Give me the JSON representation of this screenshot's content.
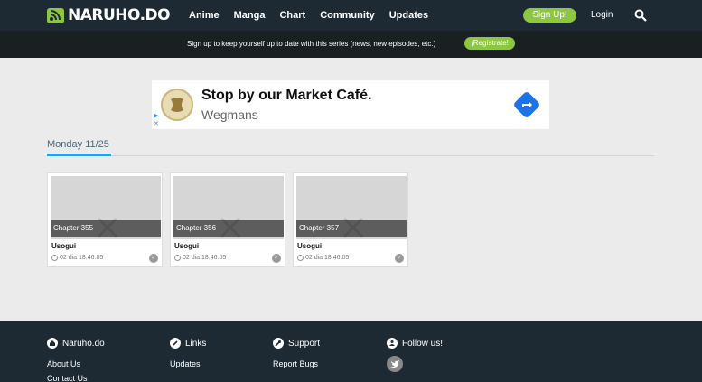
{
  "header": {
    "logo_text": "NARUHO.DO",
    "nav": [
      "Anime",
      "Manga",
      "Chart",
      "Community",
      "Updates"
    ],
    "signup_label": "Sign Up!",
    "login_label": "Login"
  },
  "infobar": {
    "text": "Sign up to keep yourself up to date with this series (news, new episodes, etc.)",
    "register_label": "¡Regístrate!"
  },
  "ad": {
    "title": "Stop by our Market Café.",
    "subtitle": "Wegmans"
  },
  "section": {
    "date": "Monday 11/25"
  },
  "cards": [
    {
      "chapter": "Chapter 355",
      "title": "Usogui",
      "time": "02 dia 18:46:05"
    },
    {
      "chapter": "Chapter 356",
      "title": "Usogui",
      "time": "02 dia 18:46:05"
    },
    {
      "chapter": "Chapter 357",
      "title": "Usogui",
      "time": "02 dia 18:46:05"
    }
  ],
  "footer": {
    "col1": {
      "title": "Naruho.do",
      "links": [
        "About Us",
        "Contact Us"
      ]
    },
    "col2": {
      "title": "Links",
      "links": [
        "Updates"
      ]
    },
    "col3": {
      "title": "Support",
      "links": [
        "Report Bugs"
      ]
    },
    "col4": {
      "title": "Follow us!"
    }
  },
  "colors": {
    "accent_green": "#8dc63f",
    "nav_bg": "#1d2a33",
    "link_blue": "#2fa0d8"
  },
  "icons": [
    "rss-logo-icon",
    "search-icon",
    "ad-arrow-icon",
    "clock-icon",
    "check-icon",
    "home-icon",
    "link-icon",
    "wrench-icon",
    "users-icon",
    "twitter-icon"
  ]
}
